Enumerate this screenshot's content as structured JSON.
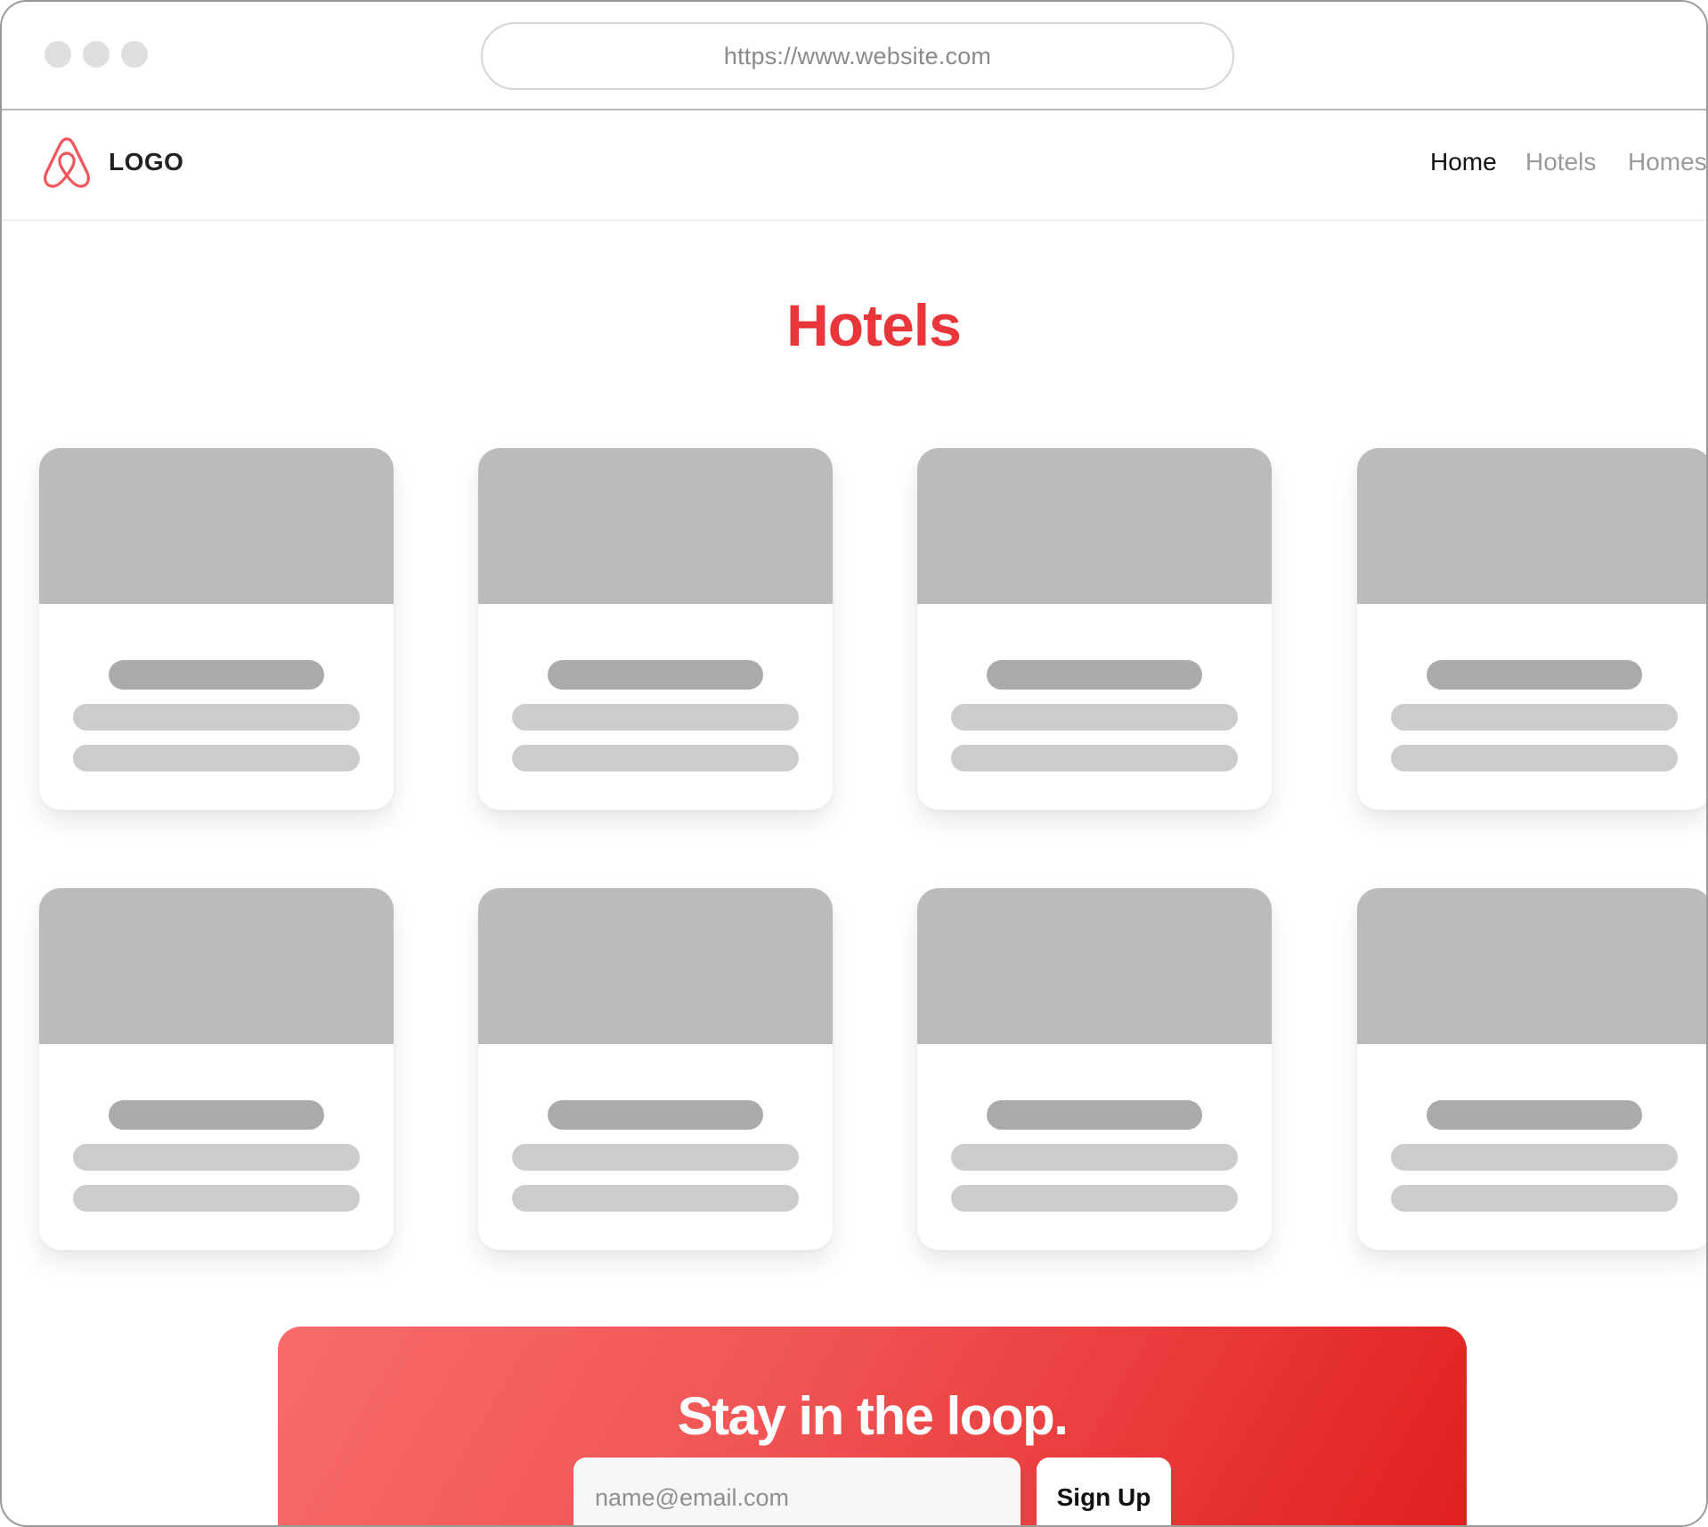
{
  "browser": {
    "url": "https://www.website.com"
  },
  "navbar": {
    "logo_text": "LOGO",
    "links": [
      {
        "label": "Home",
        "active": true
      },
      {
        "label": "Hotels",
        "active": false
      },
      {
        "label": "Homes",
        "active": false
      }
    ]
  },
  "main": {
    "title": "Hotels",
    "cards_count": 8
  },
  "newsletter": {
    "title": "Stay in the loop.",
    "email_placeholder": "name@email.com",
    "button_label": "Sign Up"
  },
  "colors": {
    "accent": "#e8363a",
    "gradient_start": "#f96b6b",
    "gradient_end": "#e01e1e",
    "card_image_placeholder": "#bbbbbb",
    "skeleton_dark": "#aaaaaa",
    "skeleton_light": "#cccccc"
  }
}
